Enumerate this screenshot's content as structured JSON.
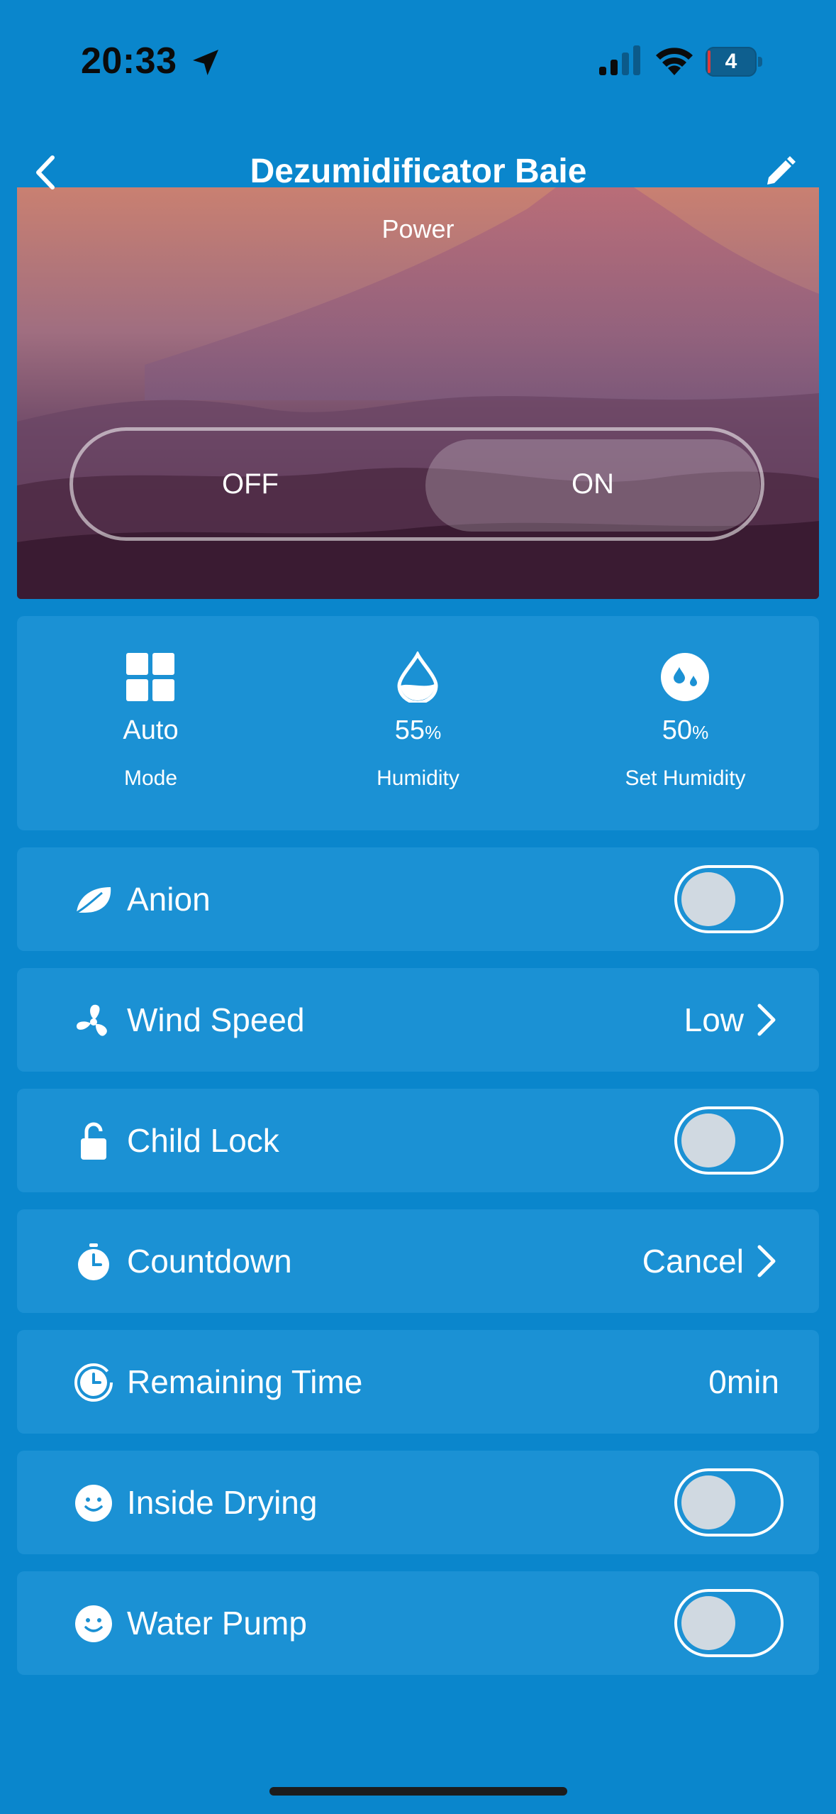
{
  "status_bar": {
    "time": "20:33",
    "battery": "4"
  },
  "header": {
    "title": "Dezumidificator Baie"
  },
  "power": {
    "label": "Power",
    "off_label": "OFF",
    "on_label": "ON",
    "state": "on"
  },
  "stats": [
    {
      "icon": "grid-icon",
      "value": "Auto",
      "unit": "",
      "label": "Mode"
    },
    {
      "icon": "water-drop-icon",
      "value": "55",
      "unit": "%",
      "label": "Humidity"
    },
    {
      "icon": "humidity-set-icon",
      "value": "50",
      "unit": "%",
      "label": "Set Humidity"
    }
  ],
  "rows": {
    "anion": {
      "label": "Anion",
      "icon": "leaf-icon",
      "on": false
    },
    "wind_speed": {
      "label": "Wind Speed",
      "icon": "fan-icon",
      "value": "Low"
    },
    "child_lock": {
      "label": "Child Lock",
      "icon": "lock-icon",
      "on": false
    },
    "countdown": {
      "label": "Countdown",
      "icon": "timer-icon",
      "value": "Cancel"
    },
    "remaining_time": {
      "label": "Remaining Time",
      "icon": "clock-icon",
      "value": "0min"
    },
    "inside_drying": {
      "label": "Inside Drying",
      "icon": "smiley-icon",
      "on": false
    },
    "water_pump": {
      "label": "Water Pump",
      "icon": "smiley-icon",
      "on": false
    }
  },
  "colors": {
    "background": "#0a86cc",
    "card": "#1b91d4",
    "knob": "#d0d9e1"
  }
}
